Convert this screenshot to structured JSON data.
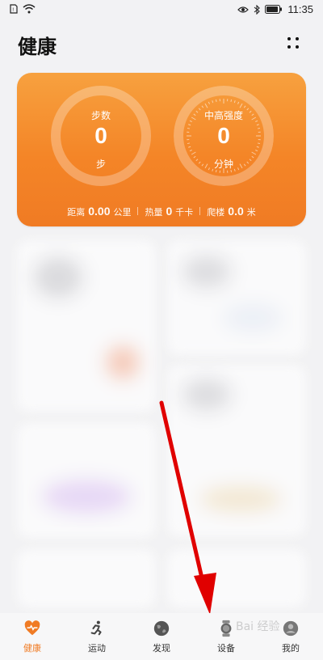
{
  "status_bar": {
    "time": "11:35"
  },
  "header": {
    "title": "健康"
  },
  "activity_card": {
    "steps": {
      "label": "步数",
      "value": "0",
      "unit": "步"
    },
    "intensity": {
      "label": "中高强度",
      "value": "0",
      "unit": "分钟"
    },
    "stats": [
      {
        "label": "距离",
        "value": "0.00",
        "unit": "公里"
      },
      {
        "label": "热量",
        "value": "0",
        "unit": "千卡"
      },
      {
        "label": "爬楼",
        "value": "0.0",
        "unit": "米"
      }
    ],
    "colors": {
      "gradient_top": "#f7a13f",
      "gradient_bottom": "#f07b24"
    }
  },
  "tabbar": {
    "items": [
      {
        "label": "健康",
        "icon": "heart-pulse-icon",
        "active": true
      },
      {
        "label": "运动",
        "icon": "running-icon",
        "active": false
      },
      {
        "label": "发现",
        "icon": "globe-icon",
        "active": false
      },
      {
        "label": "设备",
        "icon": "watch-icon",
        "active": false
      },
      {
        "label": "我的",
        "icon": "profile-icon",
        "active": false
      }
    ],
    "accent": "#f07b24"
  },
  "watermark": {
    "text": "Bai 经验"
  }
}
